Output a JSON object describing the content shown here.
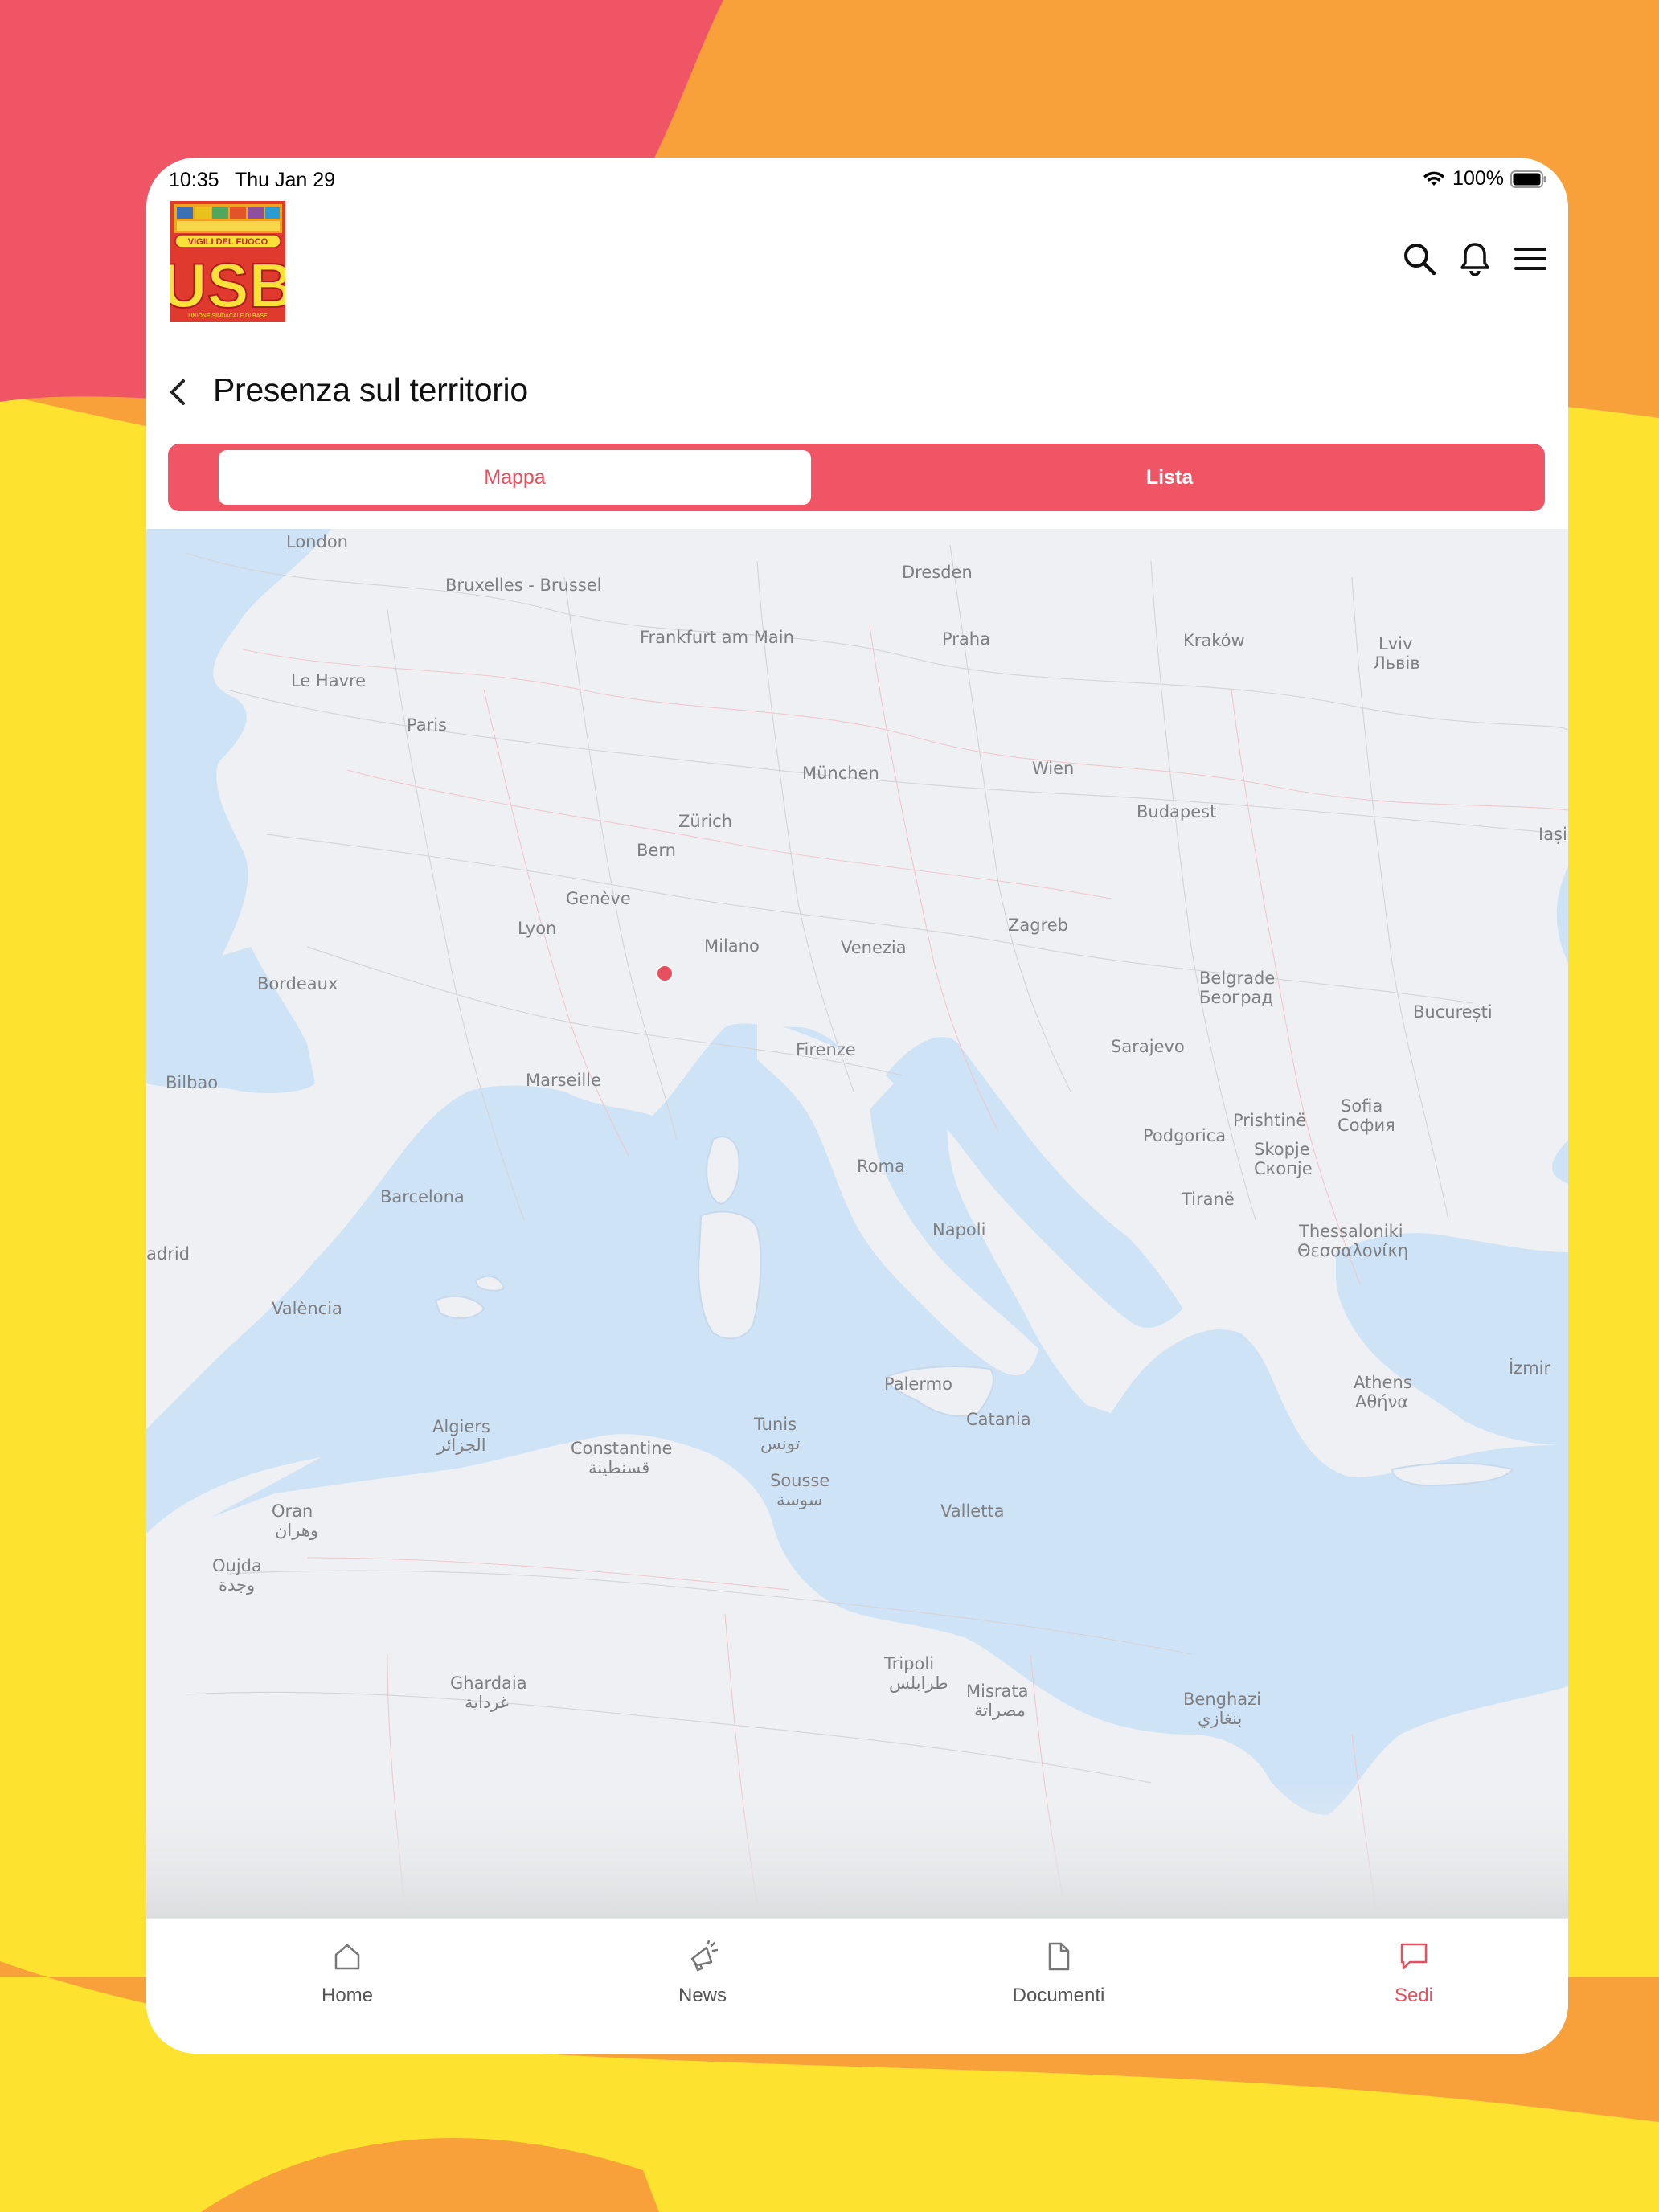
{
  "status_bar": {
    "time": "10:35",
    "date": "Thu Jan 29",
    "battery": "100%"
  },
  "header": {
    "logo_text": "USB",
    "logo_subtitle": "VIGILI DEL FUOCO",
    "logo_footer": "UNIONE SINDACALE DI BASE"
  },
  "page": {
    "title": "Presenza sul territorio"
  },
  "segmented_control": {
    "selected": "Mappa",
    "options": [
      "Mappa",
      "Lista"
    ]
  },
  "map": {
    "cities": [
      "London",
      "Bruxelles - Brussel",
      "Dresden",
      "Frankfurt am Main",
      "Praha",
      "Kraków",
      "Lviv",
      "Львів",
      "Le Havre",
      "Paris",
      "München",
      "Wien",
      "Zürich",
      "Budapest",
      "Bern",
      "Iași",
      "Genève",
      "Lyon",
      "Milano",
      "Venezia",
      "Zagreb",
      "Bordeaux",
      "Belgrade",
      "Београд",
      "București",
      "Firenze",
      "Sarajevo",
      "Bilbao",
      "Marseille",
      "Sofia",
      "София",
      "Prishtinë",
      "Podgorica",
      "Skopje",
      "Скопје",
      "Roma",
      "Barcelona",
      "Tiranë",
      "Napoli",
      "Thessaloniki",
      "Θεσσαλονίκη",
      "adrid",
      "València",
      "İzmir",
      "Palermo",
      "Athens",
      "Αθήνα",
      "Catania",
      "Algiers",
      "الجزائر",
      "Tunis",
      "تونس",
      "Constantine",
      "قسنطينة",
      "Sousse",
      "سوسة",
      "Oran",
      "وهران",
      "Valletta",
      "Oujda",
      "وجدة",
      "Tripoli",
      "طرابلس",
      "Ghardaia",
      "غرداية",
      "Misrata",
      "مصراتة",
      "Benghazi",
      "بنغازي"
    ]
  },
  "tabs": {
    "home": "Home",
    "news": "News",
    "documenti": "Documenti",
    "sedi": "Sedi",
    "active": "Sedi"
  },
  "colors": {
    "accent": "#F05565",
    "background_yellow": "#FDE32F",
    "background_orange": "#F8A13A",
    "background_red": "#F05565",
    "sea": "#CFE3F6",
    "land": "#EEF0F3"
  }
}
